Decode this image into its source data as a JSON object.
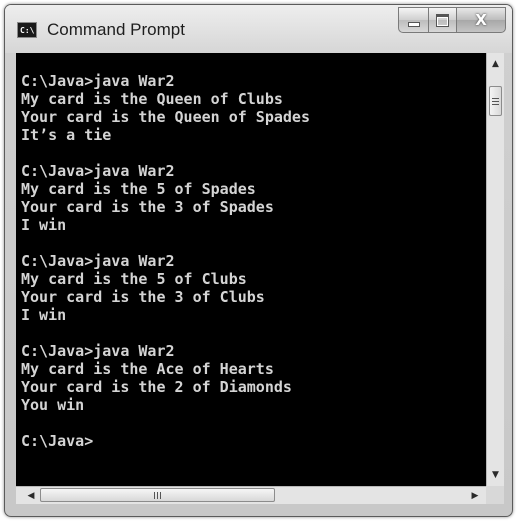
{
  "window": {
    "title": "Command Prompt",
    "icon": "cmd-window-icon",
    "icon_text": "C:\\"
  },
  "caption_buttons": {
    "minimize_icon": "minimize-icon",
    "maximize_icon": "maximize-icon",
    "close_label": "X"
  },
  "console": {
    "background": "#000000",
    "foreground": "#d4d4d4",
    "lines": [
      "",
      "C:\\Java>java War2",
      "My card is the Queen of Clubs",
      "Your card is the Queen of Spades",
      "It’s a tie",
      "",
      "C:\\Java>java War2",
      "My card is the 5 of Spades",
      "Your card is the 3 of Spades",
      "I win",
      "",
      "C:\\Java>java War2",
      "My card is the 5 of Clubs",
      "Your card is the 3 of Clubs",
      "I win",
      "",
      "C:\\Java>java War2",
      "My card is the Ace of Hearts",
      "Your card is the 2 of Diamonds",
      "You win",
      "",
      "C:\\Java>"
    ]
  },
  "scrollbars": {
    "up_arrow": "▲",
    "down_arrow": "▼",
    "left_arrow": "◀",
    "right_arrow": "▶"
  }
}
